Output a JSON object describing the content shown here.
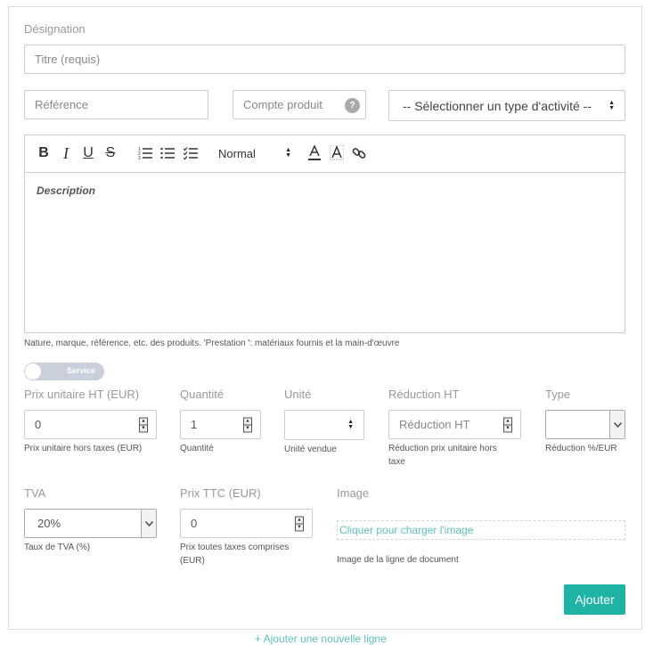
{
  "form": {
    "designation_label": "Désignation",
    "title_placeholder": "Titre (requis)",
    "reference_placeholder": "Référence",
    "compte_placeholder": "Compte produit",
    "compte_help_icon": "?",
    "activity_select": "-- Sélectionner un type d'activité --",
    "editor": {
      "toolbar": {
        "bold": "B",
        "italic": "I",
        "underline": "U",
        "strike": "S",
        "heading_select": "Normal",
        "icons": [
          "bold-icon",
          "italic-icon",
          "underline-icon",
          "strike-icon",
          "ordered-list-icon",
          "bullet-list-icon",
          "check-list-icon",
          "text-color-icon",
          "background-color-icon",
          "link-icon"
        ]
      },
      "placeholder": "Description"
    },
    "description_help": "Nature, marque, référence, etc. des produits. 'Prestation ': matériaux fournis et la main-d'œuvre",
    "toggle_label": "Service",
    "prix_unitaire": {
      "label": "Prix unitaire HT (EUR)",
      "value": "0",
      "help": "Prix unitaire hors taxes (EUR)"
    },
    "quantite": {
      "label": "Quantité",
      "value": "1",
      "help": "Quantité"
    },
    "unite": {
      "label": "Unité",
      "value": "",
      "help": "Unité vendue"
    },
    "reduction": {
      "label": "Réduction HT",
      "placeholder": "Réduction HT",
      "help_line1": "Réduction prix unitaire hors",
      "help_line2": "taxe"
    },
    "type": {
      "label": "Type",
      "value": "",
      "help": "Réduction %/EUR"
    },
    "tva": {
      "label": "TVA",
      "value": "20%",
      "help": "Taux de TVA (%)"
    },
    "prix_ttc": {
      "label": "Prix TTC (EUR)",
      "value": "0",
      "help_line1": "Prix toutes taxes comprises",
      "help_line2": "(EUR)"
    },
    "image": {
      "label": "Image",
      "link": "Cliquer pour charger l'image",
      "help": "Image de la ligne de document"
    },
    "submit_label": "Ajouter"
  },
  "footer_link": "+ Ajouter une nouvelle ligne",
  "colors": {
    "accent": "#1fb3a6",
    "link": "#5bc0be"
  }
}
